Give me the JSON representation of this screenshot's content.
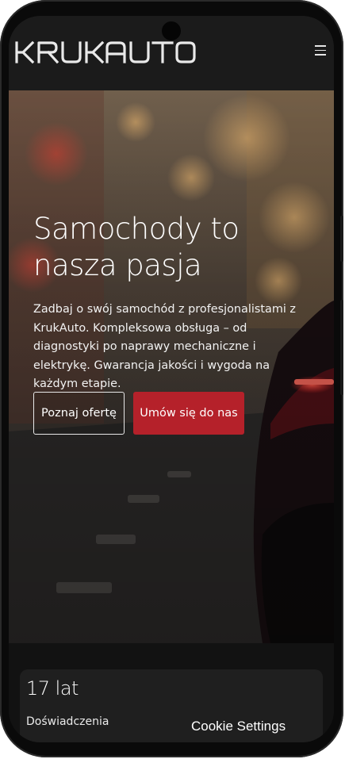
{
  "header": {
    "logo_text": "KRUKAUTO",
    "menu_icon": "hamburger-menu-icon"
  },
  "hero": {
    "title": "Samochody to nasza pasja",
    "description": "Zadbaj o swój samochód z profesjonalistami z KrukAuto. Kompleksowa obsługa – od diagnostyki po naprawy mechaniczne i elektrykę. Gwarancja jakości i wygoda na każdym etapie.",
    "buttons": {
      "secondary_label": "Poznaj ofertę",
      "primary_label": "Umów się do nas"
    }
  },
  "stats": [
    {
      "value": "17 lat",
      "label": "Doświadczenia"
    }
  ],
  "cookie": {
    "label": "Cookie Settings"
  },
  "colors": {
    "accent": "#b5212a",
    "header_bg": "#1b1b1b",
    "card_bg": "#1f1f1f"
  }
}
